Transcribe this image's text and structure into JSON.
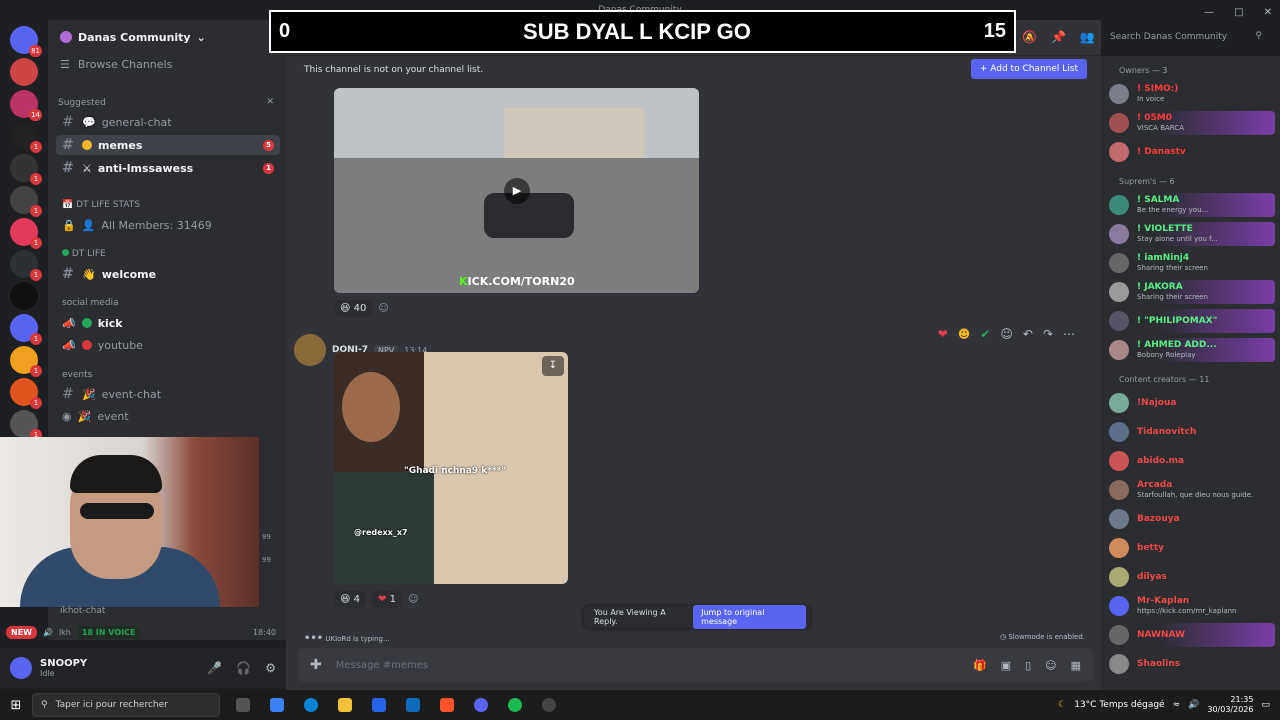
{
  "window": {
    "title": "Danas Community"
  },
  "server": {
    "name": "Danas Community",
    "browse_label": "Browse Channels"
  },
  "overlay": {
    "left_count": "0",
    "text": "SUB DYAL L KCIP GO",
    "right_count": "15"
  },
  "sidebar": {
    "suggested_label": "Suggested",
    "channels_suggested": [
      {
        "name": "general-chat",
        "badge": ""
      },
      {
        "name": "memes",
        "badge": "5"
      },
      {
        "name": "anti-lmssawess",
        "badge": "1"
      }
    ],
    "cat_stats": "DT LIFE STATS",
    "all_members": "All Members: 31469",
    "cat_life": "DT LIFE",
    "welcome": "welcome",
    "cat_social": "social media",
    "kick": "kick",
    "youtube": "youtube",
    "cat_events": "events",
    "event_chat": "event-chat",
    "event": "event"
  },
  "rail": {
    "badges": [
      "81",
      "14",
      "1",
      "1",
      "1",
      "1",
      "1",
      "1",
      "1",
      "1",
      "1",
      "1"
    ]
  },
  "voice": {
    "new": "NEW",
    "in_voice": "18 IN VOICE",
    "time": "18:40",
    "partial1": "ikhot-chat",
    "partial2": "lkh",
    "count1": "99",
    "count2": "99"
  },
  "user": {
    "name": "SNOOPY",
    "status": "Idle"
  },
  "header": {
    "channel": "memes",
    "search_placeholder": "Search Danas Community"
  },
  "notice": {
    "text": "This channel is not on your channel list.",
    "add_label": "+ Add to Channel List"
  },
  "post1": {
    "kick_prefix": "K",
    "kick_rest": "ICK.COM/TORN20",
    "reaction_count": "40"
  },
  "post2": {
    "author": "DONI-7",
    "tag": "NPV",
    "time": "13:14",
    "caption": "\"Ghadi nchna9 k***\"",
    "handle": "@redexx_x7",
    "reaction1": "4",
    "reaction2": "1"
  },
  "reply": {
    "viewing": "You Are Viewing A Reply.",
    "jump": "Jump to original message"
  },
  "typing": "UKIoRd is typing...",
  "slowmode": "Slowmode is enabled.",
  "composer": {
    "placeholder": "Message #memes"
  },
  "members": {
    "owners_label": "Owners — 3",
    "owners": [
      {
        "name": "! SIMO:)",
        "sub": "In voice",
        "color": "#ff3b3b"
      },
      {
        "name": "! 05M0",
        "sub": "VISCA BARCA",
        "color": "#ff3b3b"
      },
      {
        "name": "! Danastv",
        "sub": "",
        "color": "#ff3b3b"
      }
    ],
    "supreme_label": "Suprem's — 6",
    "supreme": [
      {
        "name": "! SALMA",
        "sub": "Be the energy you...",
        "color": "#57f287"
      },
      {
        "name": "! VIOLETTE",
        "sub": "Stay alone until you f...",
        "color": "#57f287"
      },
      {
        "name": "! iamNinj4",
        "sub": "Sharing their screen",
        "color": "#57f287"
      },
      {
        "name": "! JAKORA",
        "sub": "Sharing their screen",
        "color": "#57f287"
      },
      {
        "name": "! \"PHILIPOMAX\"",
        "sub": "",
        "color": "#57f287"
      },
      {
        "name": "! AHMED ADD...",
        "sub": "Bobony Roleplay",
        "color": "#57f287"
      }
    ],
    "creators_label": "Content creators — 11",
    "creators": [
      {
        "name": "!Najoua",
        "sub": "",
        "color": "#f04747"
      },
      {
        "name": "Tidanovitch",
        "sub": "",
        "color": "#f04747"
      },
      {
        "name": "abido.ma",
        "sub": "",
        "color": "#f04747"
      },
      {
        "name": "Arcada",
        "sub": "Starfoullah, que dieu nous guide.",
        "color": "#f04747"
      },
      {
        "name": "Bazouya",
        "sub": "",
        "color": "#f04747"
      },
      {
        "name": "betty",
        "sub": "",
        "color": "#f04747"
      },
      {
        "name": "dilyas",
        "sub": "",
        "color": "#f04747"
      },
      {
        "name": "Mr-Kaplan",
        "sub": "https://kick.com/mr_kaplann",
        "color": "#f04747"
      },
      {
        "name": "NAWNAW",
        "sub": "",
        "color": "#f04747"
      },
      {
        "name": "Shaolins",
        "sub": "",
        "color": "#f04747"
      }
    ]
  },
  "taskbar": {
    "search": "Taper ici pour rechercher",
    "weather": "13°C  Temps dégagé",
    "time": "21:35",
    "date": "30/03/2026"
  }
}
